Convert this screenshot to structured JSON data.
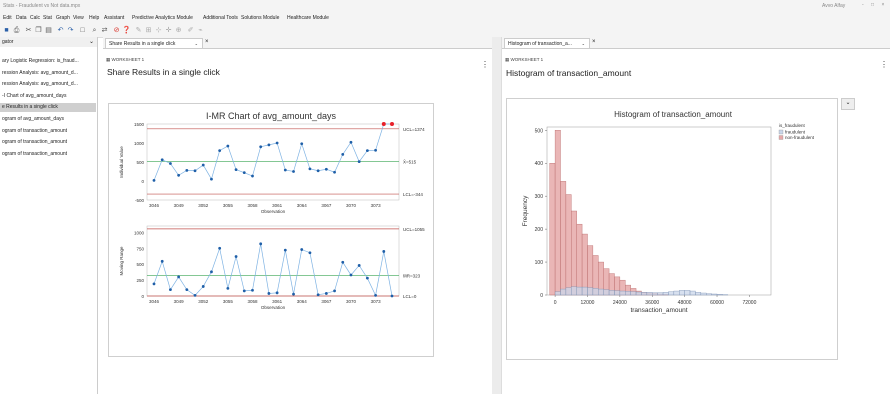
{
  "window": {
    "title": "Stats - Fraudulent vs Not data.mpx",
    "user": "Avvo Alfay",
    "controls": "- □ ×"
  },
  "menu": [
    "Edit",
    "Data",
    "Calc",
    "Stat",
    "Graph",
    "View",
    "Help",
    "Assistant",
    "Predictive Analytics Module",
    "Additional Tools",
    "Solutions Module",
    "Healthcare Module"
  ],
  "toolbar": {
    "icons": [
      "save-icon",
      "print-icon",
      "cut-icon",
      "copy-icon",
      "paste-icon",
      "undo-icon",
      "redo-icon",
      "window-icon",
      "find-icon",
      "replace-icon",
      "stop-icon",
      "help-icon",
      "brush-icon",
      "graph-edit-icon",
      "brush-select-icon",
      "crosshair-icon",
      "zoom-icon",
      "edit-annotation-icon",
      "link-icon"
    ]
  },
  "navigator": {
    "header": "gator",
    "items": [
      "ary Logistic Regression: is_fraud...",
      "ression Analysis: avg_amount_d...",
      "ression Analysis: avg_amount_d...",
      "-I Chart of avg_amount_days",
      "e Results in a single click",
      "ogram of avg_amount_days",
      "ogram of transaction_amount",
      "ogram of transaction_amount",
      "ogram of transaction_amount"
    ],
    "selected_index": 4
  },
  "left_pane": {
    "tab_label": "Share Results in a single click",
    "tab_close": "×",
    "worksheet_label": "WORKSHEET 1",
    "title": "Share Results in a single click",
    "kebab": "⋮"
  },
  "right_pane": {
    "tab_label": "Histogram of transaction_a...",
    "tab_close": "×",
    "worksheet_label": "WORKSHEET 1",
    "title": "Histogram of transaction_amount",
    "kebab": "⋮",
    "expand_glyph": "⌄"
  },
  "imr_chart": {
    "title": "I-MR Chart of avg_amount_days",
    "x_label": "Observation",
    "x_ticks": [
      "3046",
      "3049",
      "3052",
      "3055",
      "3058",
      "3061",
      "3064",
      "3067",
      "3070",
      "3073"
    ],
    "i_chart": {
      "ylabel": "Individual Value",
      "y_ticks": [
        "1500",
        "1000",
        "500",
        "0",
        "-500"
      ],
      "y_range": [
        -500,
        1500
      ],
      "ucl_label": "UCL=1374",
      "ucl": 1374,
      "mean_label": "X̄=515",
      "mean": 515,
      "lcl_label": "LCL=-344",
      "lcl": -344,
      "values": [
        15,
        560,
        460,
        150,
        280,
        270,
        420,
        50,
        800,
        920,
        300,
        220,
        130,
        900,
        950,
        1000,
        290,
        250,
        980,
        320,
        270,
        310,
        230,
        700,
        1020,
        510,
        800,
        810,
        1500,
        1500
      ],
      "out_of_control_color": "#e8202a",
      "point_color": "#1f5fa8",
      "line_color": "#7fb3e3",
      "limit_color": "#c0504d",
      "center_color": "#3aa655"
    },
    "mr_chart": {
      "ylabel": "Moving Range",
      "y_ticks": [
        "1000",
        "750",
        "500",
        "250",
        "0"
      ],
      "y_range": [
        0,
        1100
      ],
      "ucl_label": "UCL=1055",
      "ucl": 1055,
      "mean_label": "M̄R=323",
      "mean": 323,
      "lcl_label": "LCL=0",
      "lcl": 0,
      "values": [
        190,
        545,
        100,
        300,
        100,
        10,
        150,
        380,
        750,
        120,
        620,
        80,
        90,
        820,
        40,
        50,
        720,
        30,
        730,
        680,
        20,
        40,
        80,
        530,
        330,
        480,
        280,
        10,
        700,
        0
      ]
    }
  },
  "chart_data": {
    "type": "bar",
    "title": "Histogram of transaction_amount",
    "xlabel": "transaction_amount",
    "ylabel": "Frequency",
    "x_ticks": [
      "0",
      "12000",
      "24000",
      "36000",
      "48000",
      "60000",
      "72000"
    ],
    "y_ticks": [
      "0",
      "100",
      "200",
      "300",
      "400",
      "500"
    ],
    "xlim": [
      -3000,
      80000
    ],
    "ylim": [
      0,
      510
    ],
    "bin_width": 2000,
    "legend": {
      "title": "is_fraudulent",
      "placement": "top-right"
    },
    "series": [
      {
        "name": "fraudulent",
        "color": "#c9d6ea",
        "start": 0,
        "values": [
          10,
          18,
          22,
          25,
          24,
          24,
          22,
          20,
          18,
          16,
          14,
          13,
          12,
          11,
          10,
          9,
          8,
          8,
          7,
          7,
          8,
          10,
          12,
          14,
          14,
          12,
          8,
          6,
          4,
          3,
          2,
          1
        ]
      },
      {
        "name": "non-fraudulent",
        "color": "#e6a9a9",
        "start": -2000,
        "values": [
          400,
          500,
          345,
          305,
          255,
          215,
          185,
          150,
          120,
          100,
          80,
          65,
          55,
          45,
          30,
          20,
          12,
          8,
          6,
          5,
          3,
          2
        ]
      }
    ]
  }
}
